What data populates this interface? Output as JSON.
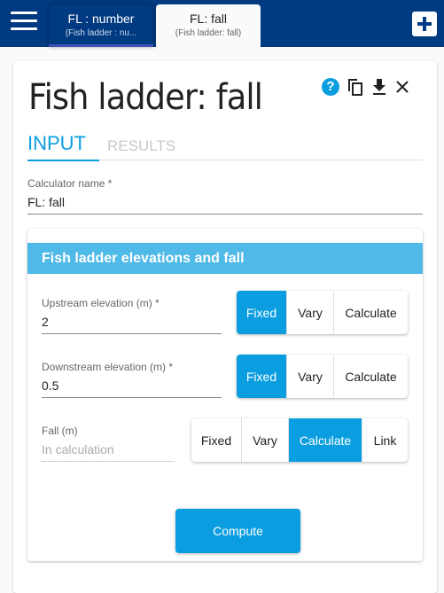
{
  "topbar": {
    "tabs": [
      {
        "title": "FL : number",
        "subtitle": "(Fish ladder : nu..."
      },
      {
        "title": "FL: fall",
        "subtitle": "(Fish ladder: fall)"
      }
    ]
  },
  "card": {
    "title": "Fish ladder: fall",
    "icons": [
      "help-icon",
      "copy-icon",
      "download-icon",
      "close-icon"
    ],
    "help_glyph": "?",
    "tabs": {
      "input": "INPUT",
      "results": "RESULTS"
    },
    "calculator_name": {
      "label": "Calculator name *",
      "value": "FL: fall"
    }
  },
  "panel": {
    "header": "Fish ladder elevations and fall",
    "params": [
      {
        "label": "Upstream elevation (m) *",
        "value": "2",
        "options": [
          "Fixed",
          "Vary",
          "Calculate"
        ],
        "selected": "Fixed"
      },
      {
        "label": "Downstream elevation (m) *",
        "value": "0.5",
        "options": [
          "Fixed",
          "Vary",
          "Calculate"
        ],
        "selected": "Fixed"
      },
      {
        "label": "Fall (m)",
        "value": "In calculation",
        "options": [
          "Fixed",
          "Vary",
          "Calculate",
          "Link"
        ],
        "selected": "Calculate"
      }
    ],
    "compute_label": "Compute"
  },
  "colors": {
    "topbar": "#003a80",
    "accent": "#0a9ee0",
    "panel_header": "#4fb9e8"
  }
}
